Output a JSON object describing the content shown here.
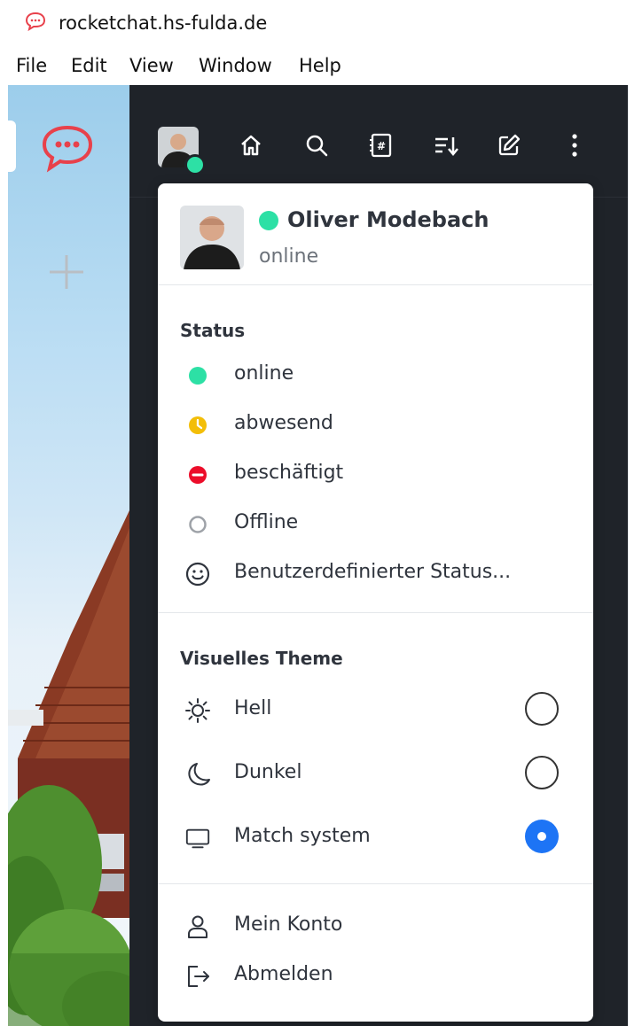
{
  "window": {
    "title": "rocketchat.hs-fulda.de"
  },
  "menubar": {
    "items": [
      {
        "label": "File"
      },
      {
        "label": "Edit"
      },
      {
        "label": "View"
      },
      {
        "label": "Window"
      },
      {
        "label": "Help"
      }
    ]
  },
  "rail": {
    "server_icon": "rocket-chat-logo-icon",
    "add_icon": "plus-icon"
  },
  "topbar": {
    "icons": [
      "avatar",
      "home-icon",
      "search-icon",
      "directory-icon",
      "sort-icon",
      "create-new-icon",
      "kebab-menu-icon"
    ]
  },
  "user_menu": {
    "user": {
      "name": "Oliver Modebach",
      "status": "online",
      "status_color": "#2de0a5"
    },
    "status_section": {
      "title": "Status",
      "items": [
        {
          "label": "online",
          "icon": "online-dot-icon",
          "color": "#2de0a5"
        },
        {
          "label": "abwesend",
          "icon": "away-clock-icon",
          "color": "#f3be08"
        },
        {
          "label": "beschäftigt",
          "icon": "busy-minus-icon",
          "color": "#ec0d2a"
        },
        {
          "label": "Offline",
          "icon": "offline-ring-icon",
          "color": "#9ea2a8"
        },
        {
          "label": "Benutzerdefinierter Status...",
          "icon": "smiley-icon"
        }
      ]
    },
    "theme_section": {
      "title": "Visuelles Theme",
      "items": [
        {
          "label": "Hell",
          "icon": "sun-icon",
          "selected": false
        },
        {
          "label": "Dunkel",
          "icon": "moon-icon",
          "selected": false
        },
        {
          "label": "Match system",
          "icon": "monitor-icon",
          "selected": true
        }
      ],
      "accent_color": "#1d74f5"
    },
    "account_section": {
      "items": [
        {
          "label": "Mein Konto",
          "icon": "user-icon"
        },
        {
          "label": "Abmelden",
          "icon": "logout-icon"
        }
      ]
    }
  }
}
